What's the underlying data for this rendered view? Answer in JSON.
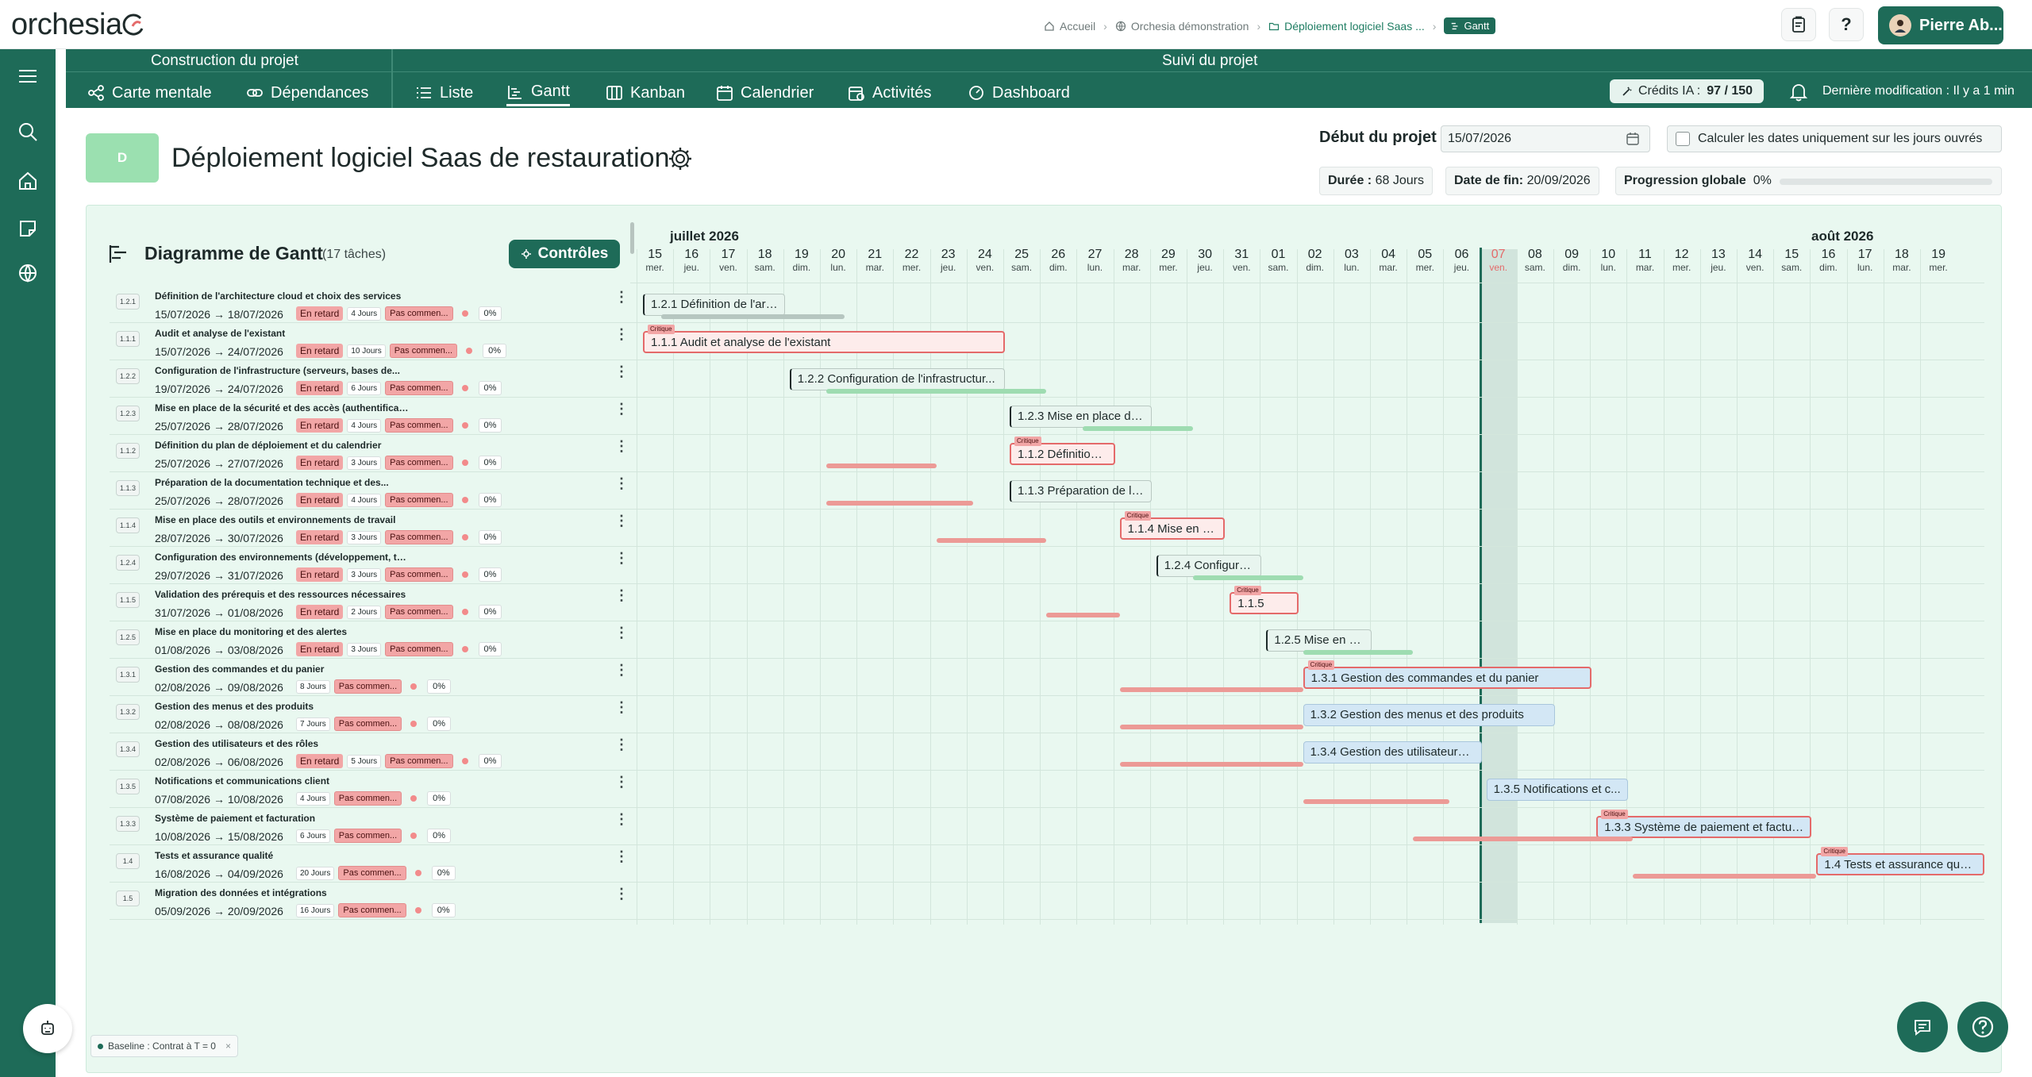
{
  "app": {
    "logo": "orchesia"
  },
  "breadcrumb": {
    "home": "Accueil",
    "workspace": "Orchesia démonstration",
    "project": "Déploiement logiciel Saas ...",
    "current": "Gantt"
  },
  "user": {
    "name": "Pierre Ab..."
  },
  "nav": {
    "section_build": "Construction du projet",
    "section_follow": "Suivi du projet",
    "items": [
      {
        "label": "Carte mentale"
      },
      {
        "label": "Dépendances"
      },
      {
        "label": "Liste"
      },
      {
        "label": "Gantt"
      },
      {
        "label": "Kanban"
      },
      {
        "label": "Calendrier"
      },
      {
        "label": "Activités"
      },
      {
        "label": "Dashboard"
      }
    ],
    "credits_label": "Crédits IA :",
    "credits_value": "97 / 150",
    "last_modified": "Dernière modification : Il y a 1 min"
  },
  "project": {
    "badge": "D",
    "title": "Déploiement logiciel Saas de restauration",
    "start_label": "Début du projet",
    "start_value": "15/07/2026",
    "workdays_label": "Calculer les dates uniquement sur les jours ouvrés",
    "duration_label": "Durée :",
    "duration_value": "68 Jours",
    "end_label": "Date de fin:",
    "end_value": "20/09/2026",
    "progress_label": "Progression globale",
    "progress_value": "0%",
    "progress_fraction": 0
  },
  "gantt": {
    "title": "Diagramme de Gantt",
    "count": "(17 tâches)",
    "controls_label": "Contrôles",
    "month_july": "juillet 2026",
    "month_aug": "août 2026",
    "days": [
      {
        "n": "15",
        "d": "mer."
      },
      {
        "n": "16",
        "d": "jeu."
      },
      {
        "n": "17",
        "d": "ven."
      },
      {
        "n": "18",
        "d": "sam."
      },
      {
        "n": "19",
        "d": "dim."
      },
      {
        "n": "20",
        "d": "lun."
      },
      {
        "n": "21",
        "d": "mar."
      },
      {
        "n": "22",
        "d": "mer."
      },
      {
        "n": "23",
        "d": "jeu."
      },
      {
        "n": "24",
        "d": "ven."
      },
      {
        "n": "25",
        "d": "sam."
      },
      {
        "n": "26",
        "d": "dim."
      },
      {
        "n": "27",
        "d": "lun."
      },
      {
        "n": "28",
        "d": "mar."
      },
      {
        "n": "29",
        "d": "mer."
      },
      {
        "n": "30",
        "d": "jeu."
      },
      {
        "n": "31",
        "d": "ven."
      },
      {
        "n": "01",
        "d": "sam."
      },
      {
        "n": "02",
        "d": "dim."
      },
      {
        "n": "03",
        "d": "lun."
      },
      {
        "n": "04",
        "d": "mar."
      },
      {
        "n": "05",
        "d": "mer."
      },
      {
        "n": "06",
        "d": "jeu."
      },
      {
        "n": "07",
        "d": "ven."
      },
      {
        "n": "08",
        "d": "sam."
      },
      {
        "n": "09",
        "d": "dim."
      },
      {
        "n": "10",
        "d": "lun."
      },
      {
        "n": "11",
        "d": "mar."
      },
      {
        "n": "12",
        "d": "mer."
      },
      {
        "n": "13",
        "d": "jeu."
      },
      {
        "n": "14",
        "d": "ven."
      },
      {
        "n": "15",
        "d": "sam."
      },
      {
        "n": "16",
        "d": "dim."
      },
      {
        "n": "17",
        "d": "lun."
      },
      {
        "n": "18",
        "d": "mar."
      },
      {
        "n": "19",
        "d": "mer."
      }
    ],
    "today_label": {
      "n": "07",
      "d": "ven."
    },
    "critical_tag": "Critique",
    "late_label": "En retard",
    "tasks": [
      {
        "code": "1.2.1",
        "name": "Définition de l'architecture cloud et choix des services",
        "dates": "15/07/2026 → 18/07/2026",
        "late": true,
        "days": "4 Jours",
        "status": "Pas commen...",
        "pct": "0%",
        "bar": "1.2.1 Définition de l'arc..."
      },
      {
        "code": "1.1.1",
        "name": "Audit et analyse de l'existant",
        "dates": "15/07/2026 → 24/07/2026",
        "late": true,
        "days": "10 Jours",
        "status": "Pas commen...",
        "pct": "0%",
        "bar": "1.1.1 Audit et analyse de l'existant"
      },
      {
        "code": "1.2.2",
        "name": "Configuration de l'infrastructure (serveurs, bases de...",
        "dates": "19/07/2026 → 24/07/2026",
        "late": true,
        "days": "6 Jours",
        "status": "Pas commen...",
        "pct": "0%",
        "bar": "1.2.2 Configuration de l'infrastructur..."
      },
      {
        "code": "1.2.3",
        "name": "Mise en place de la sécurité et des accès (authentification,...",
        "dates": "25/07/2026 → 28/07/2026",
        "late": true,
        "days": "4 Jours",
        "status": "Pas commen...",
        "pct": "0%",
        "bar": "1.2.3 Mise en place de ..."
      },
      {
        "code": "1.1.2",
        "name": "Définition du plan de déploiement et du calendrier",
        "dates": "25/07/2026 → 27/07/2026",
        "late": true,
        "days": "3 Jours",
        "status": "Pas commen...",
        "pct": "0%",
        "bar": "1.1.2 Définition ..."
      },
      {
        "code": "1.1.3",
        "name": "Préparation de la documentation technique et des...",
        "dates": "25/07/2026 → 28/07/2026",
        "late": true,
        "days": "4 Jours",
        "status": "Pas commen...",
        "pct": "0%",
        "bar": "1.1.3 Préparation de la ..."
      },
      {
        "code": "1.1.4",
        "name": "Mise en place des outils et environnements de travail",
        "dates": "28/07/2026 → 30/07/2026",
        "late": true,
        "days": "3 Jours",
        "status": "Pas commen...",
        "pct": "0%",
        "bar": "1.1.4 Mise en pl..."
      },
      {
        "code": "1.2.4",
        "name": "Configuration des environnements (développement, test,...",
        "dates": "29/07/2026 → 31/07/2026",
        "late": true,
        "days": "3 Jours",
        "status": "Pas commen...",
        "pct": "0%",
        "bar": "1.2.4 Configurat..."
      },
      {
        "code": "1.1.5",
        "name": "Validation des prérequis et des ressources nécessaires",
        "dates": "31/07/2026 → 01/08/2026",
        "late": true,
        "days": "2 Jours",
        "status": "Pas commen...",
        "pct": "0%",
        "bar": "1.1.5"
      },
      {
        "code": "1.2.5",
        "name": "Mise en place du monitoring et des alertes",
        "dates": "01/08/2026 → 03/08/2026",
        "late": true,
        "days": "3 Jours",
        "status": "Pas commen...",
        "pct": "0%",
        "bar": "1.2.5 Mise en pl..."
      },
      {
        "code": "1.3.1",
        "name": "Gestion des commandes et du panier",
        "dates": "02/08/2026 → 09/08/2026",
        "late": false,
        "days": "8 Jours",
        "status": "Pas commen...",
        "pct": "0%",
        "bar": "1.3.1 Gestion des commandes et du panier"
      },
      {
        "code": "1.3.2",
        "name": "Gestion des menus et des produits",
        "dates": "02/08/2026 → 08/08/2026",
        "late": false,
        "days": "7 Jours",
        "status": "Pas commen...",
        "pct": "0%",
        "bar": "1.3.2 Gestion des menus et des produits"
      },
      {
        "code": "1.3.4",
        "name": "Gestion des utilisateurs et des rôles",
        "dates": "02/08/2026 → 06/08/2026",
        "late": true,
        "days": "5 Jours",
        "status": "Pas commen...",
        "pct": "0%",
        "bar": "1.3.4 Gestion des utilisateurs ..."
      },
      {
        "code": "1.3.5",
        "name": "Notifications et communications client",
        "dates": "07/08/2026 → 10/08/2026",
        "late": false,
        "days": "4 Jours",
        "status": "Pas commen...",
        "pct": "0%",
        "bar": "1.3.5 Notifications et c..."
      },
      {
        "code": "1.3.3",
        "name": "Système de paiement et facturation",
        "dates": "10/08/2026 → 15/08/2026",
        "late": false,
        "days": "6 Jours",
        "status": "Pas commen...",
        "pct": "0%",
        "bar": "1.3.3 Système de paiement et factura..."
      },
      {
        "code": "1.4",
        "name": "Tests et assurance qualité",
        "dates": "16/08/2026 → 04/09/2026",
        "late": false,
        "days": "20 Jours",
        "status": "Pas commen...",
        "pct": "0%",
        "bar": "1.4 Tests et assurance qualité"
      },
      {
        "code": "1.5",
        "name": "Migration des données et intégrations",
        "dates": "05/09/2026 → 20/09/2026",
        "late": false,
        "days": "16 Jours",
        "status": "Pas commen...",
        "pct": "0%",
        "bar": ""
      }
    ],
    "baseline_chip": "Baseline : Contrat à T = 0"
  }
}
